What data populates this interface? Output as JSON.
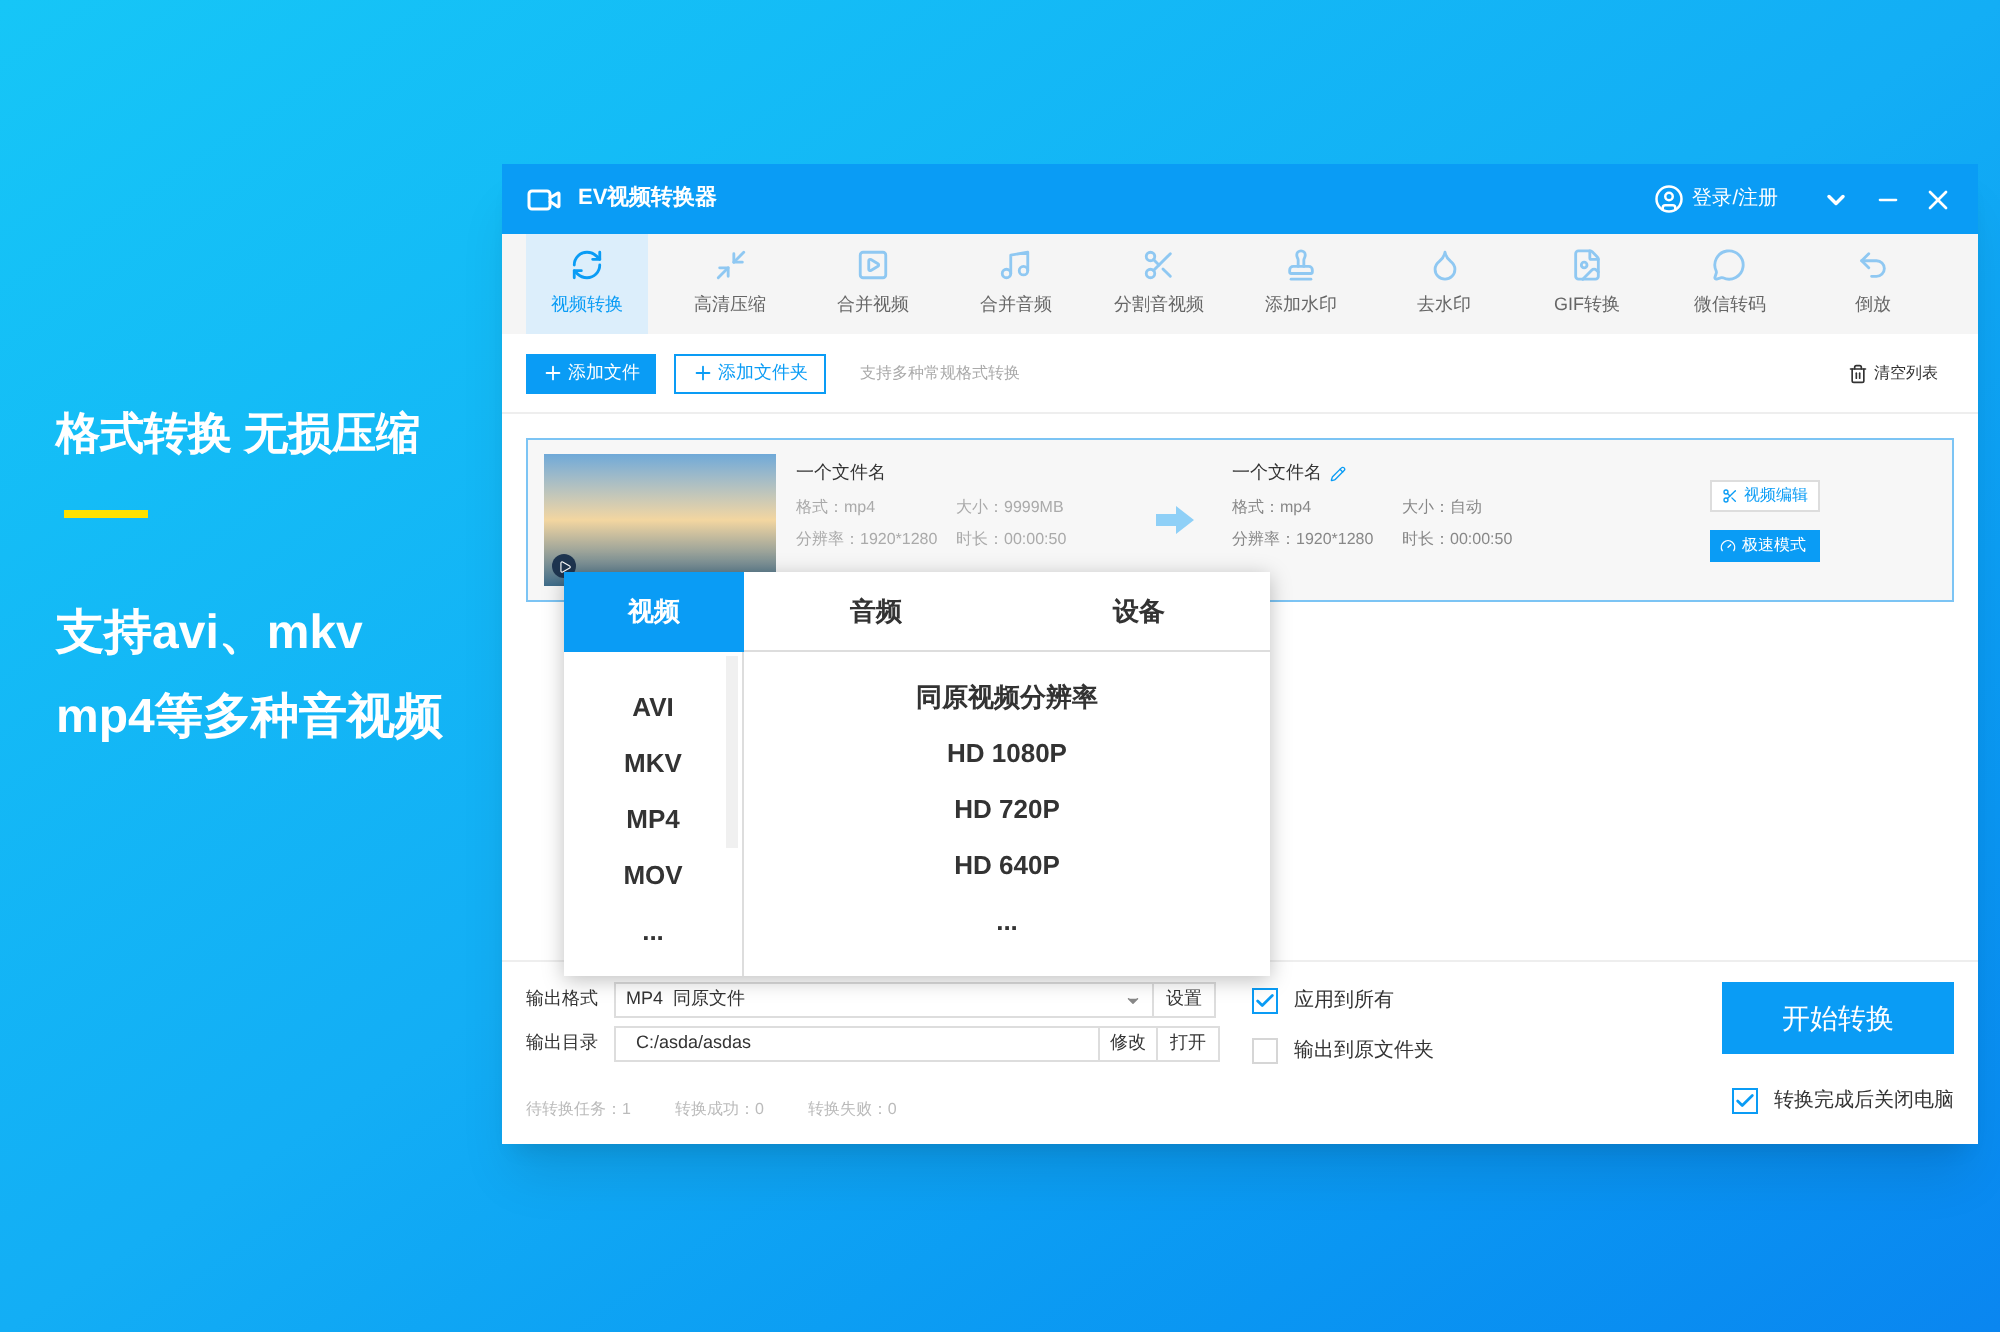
{
  "promo": {
    "headline": "格式转换 无损压缩",
    "lines": [
      "支持avi、mkv",
      "mp4等多种音视频"
    ]
  },
  "window": {
    "title": "EV视频转换器",
    "login": "登录/注册"
  },
  "tools": [
    {
      "label": "视频转换",
      "selected": true,
      "kind": "convert"
    },
    {
      "label": "高清压缩",
      "selected": false,
      "kind": "compress"
    },
    {
      "label": "合并视频",
      "selected": false,
      "kind": "video"
    },
    {
      "label": "合并音频",
      "selected": false,
      "kind": "audio"
    },
    {
      "label": "分割音视频",
      "selected": false,
      "kind": "split"
    },
    {
      "label": "添加水印",
      "selected": false,
      "kind": "stamp"
    },
    {
      "label": "去水印",
      "selected": false,
      "kind": "drop"
    },
    {
      "label": "GIF转换",
      "selected": false,
      "kind": "gif"
    },
    {
      "label": "微信转码",
      "selected": false,
      "kind": "chat"
    },
    {
      "label": "倒放",
      "selected": false,
      "kind": "reverse"
    }
  ],
  "actions": {
    "add_file": "添加文件",
    "add_folder": "添加文件夹",
    "hint": "支持多种常规格式转换",
    "clear": "清空列表"
  },
  "files": [
    {
      "name": "一个文件名",
      "format": "格式：mp4",
      "size": "大小：9999MB",
      "resolution": "分辨率：1920*1280",
      "duration": "时长：00:00:50",
      "out_name": "一个文件名",
      "out_format": "格式：mp4",
      "out_size": "大小：自动",
      "out_resolution": "分辨率：1920*1280",
      "out_duration": "时长：00:00:50",
      "edit": "视频编辑",
      "speed": "极速模式"
    }
  ],
  "popup": {
    "tabs": [
      {
        "label": "视频",
        "selected": true
      },
      {
        "label": "音频",
        "selected": false
      },
      {
        "label": "设备",
        "selected": false
      }
    ],
    "formats": [
      "AVI",
      "MKV",
      "MP4",
      "MOV",
      "..."
    ],
    "resolutions": [
      "同原视频分辨率",
      "HD 1080P",
      "HD 720P",
      "HD 640P",
      "..."
    ]
  },
  "output": {
    "format_label": "输出格式",
    "format_value": "MP4  同原文件",
    "settings": "设置",
    "dir_label": "输出目录",
    "dir_value": "C:/asda/asdas",
    "modify": "修改",
    "open": "打开",
    "apply_all": {
      "label": "应用到所有",
      "checked": true
    },
    "to_source": {
      "label": "输出到原文件夹",
      "checked": false
    },
    "start": "开始转换",
    "stats": [
      "待转换任务：1",
      "转换成功：0",
      "转换失败：0"
    ],
    "shutdown": {
      "label": "转换完成后关闭电脑",
      "checked": true
    }
  }
}
